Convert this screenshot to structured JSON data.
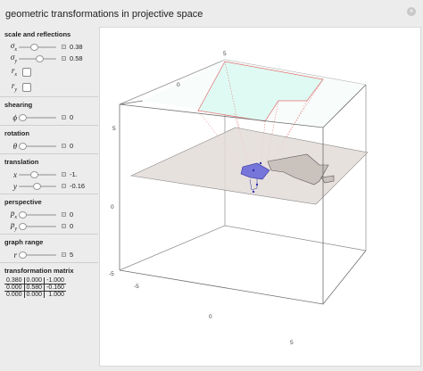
{
  "window": {
    "title": "geometric transformations in projective space"
  },
  "sections": {
    "scale": {
      "title": "scale and reflections",
      "sigma_x": {
        "label": "σ",
        "sub": "x",
        "value": "0.38",
        "fraction": 0.38
      },
      "sigma_y": {
        "label": "σ",
        "sub": "y",
        "value": "0.58",
        "fraction": 0.58
      },
      "r_x": {
        "label": "r",
        "sub": "x",
        "checked": false
      },
      "r_y": {
        "label": "r",
        "sub": "y",
        "checked": false
      }
    },
    "shearing": {
      "title": "shearing",
      "phi": {
        "label": "ϕ",
        "value": "0",
        "fraction": 0.0
      }
    },
    "rotation": {
      "title": "rotation",
      "theta": {
        "label": "θ",
        "value": "0",
        "fraction": 0.0
      }
    },
    "translation": {
      "title": "translation",
      "x": {
        "label": "x",
        "value": "-1.",
        "fraction": 0.4
      },
      "y": {
        "label": "y",
        "value": "-0.16",
        "fraction": 0.48
      }
    },
    "perspective": {
      "title": "perspective",
      "p_x": {
        "label": "p",
        "sub": "x",
        "value": "0",
        "fraction": 0.0
      },
      "p_y": {
        "label": "p",
        "sub": "y",
        "value": "0",
        "fraction": 0.0
      }
    },
    "graph_range": {
      "title": "graph range",
      "r": {
        "label": "r",
        "value": "5",
        "fraction": 0.0
      }
    },
    "matrix": {
      "title": "transformation matrix",
      "rows": [
        [
          "0.380",
          "0.000",
          "-1.000"
        ],
        [
          "0.000",
          "0.580",
          "-0.160"
        ],
        [
          "0.000",
          "0.000",
          "1.000"
        ]
      ]
    }
  },
  "plot": {
    "ticks": {
      "top_x": "5",
      "top_left": "0",
      "left_upper": "5",
      "left_mid": "0",
      "left_low1": "-5",
      "left_low2": "-5",
      "bottom_mid": "0",
      "bottom_right": "5"
    },
    "colors": {
      "box_line": "#6e6e6e",
      "plane_fill": "#e3dcd8",
      "top_fill": "#dffaf3",
      "shape": "#5a5ad8",
      "proj_line": "#e07070"
    }
  }
}
